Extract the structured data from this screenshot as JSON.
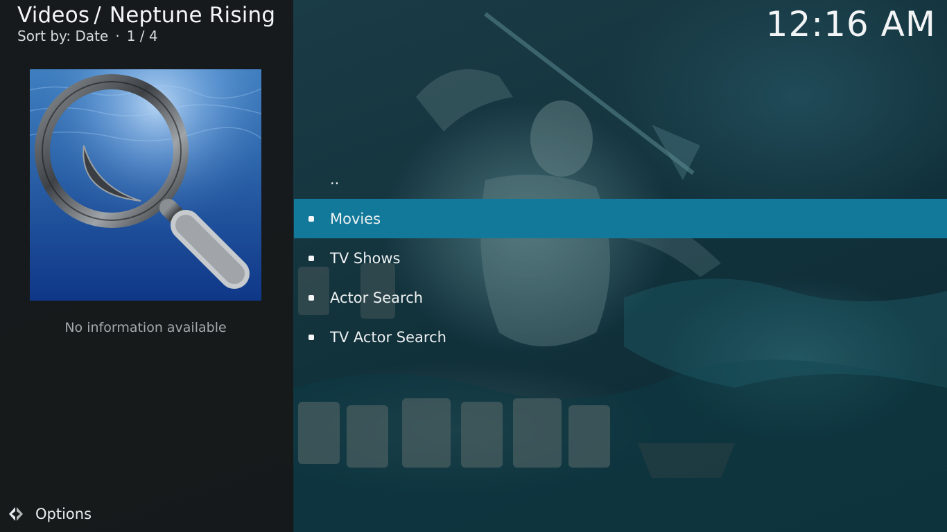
{
  "header": {
    "section": "Videos",
    "separator": "/",
    "addon_name": "Neptune Rising",
    "sort_label": "Sort by: Date",
    "dot": "·",
    "position": "1 / 4"
  },
  "clock": "12:16 AM",
  "info_panel": {
    "thumbnail_icon": "magnifier-icon",
    "no_info_text": "No information available"
  },
  "list": {
    "parent": "..",
    "items": [
      {
        "label": "Movies",
        "focused": true
      },
      {
        "label": "TV Shows",
        "focused": false
      },
      {
        "label": "Actor Search",
        "focused": false
      },
      {
        "label": "TV Actor Search",
        "focused": false
      }
    ]
  },
  "options": {
    "label": "Options",
    "icon": "options-arrows-icon"
  },
  "colors": {
    "focus": "#12799a",
    "panel": "#161819"
  }
}
